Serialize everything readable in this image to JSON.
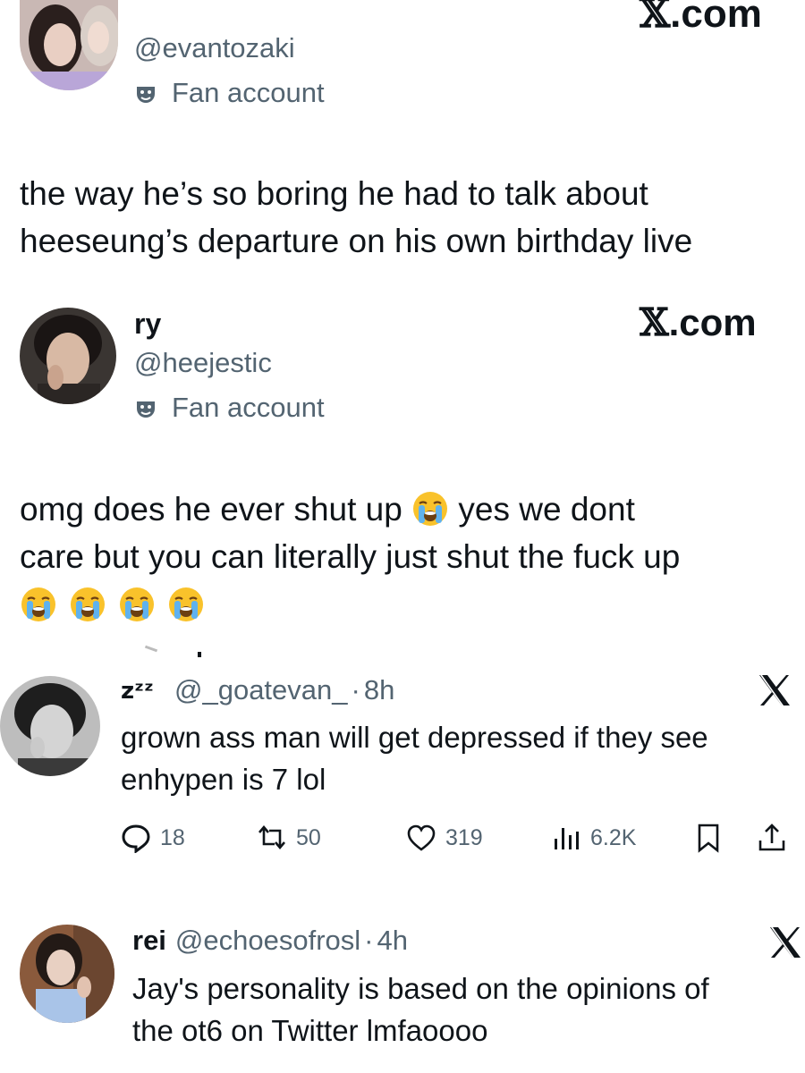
{
  "post1": {
    "handle": "@evantozaki",
    "label": "Fan account",
    "site": ".com",
    "text_lines": [
      "the way he’s so boring he had to talk about",
      "heeseung’s departure on his own birthday live"
    ]
  },
  "post2": {
    "name": "ry",
    "handle": "@heejestic",
    "label": "Fan account",
    "site": ".com",
    "text_line1_a": "omg does he ever shut up ",
    "text_line1_b": " yes we dont",
    "text_line2": "care but you can literally just shut the fuck up",
    "emoji": "loudly-crying-face-emoji",
    "trailing_emoji_count": 4
  },
  "post3": {
    "name_emoji": "zᶻᶻ",
    "handle": "@_goatevan_",
    "separator": "·",
    "time": "8h",
    "text_lines": [
      "grown ass man will get depressed if they see",
      "enhypen is 7 lol"
    ],
    "actions": {
      "replies": "18",
      "reposts": "50",
      "likes": "319",
      "views": "6.2K"
    },
    "icons": [
      "reply-icon",
      "repost-icon",
      "like-icon",
      "views-icon",
      "bookmark-icon",
      "share-icon"
    ]
  },
  "post4": {
    "name": "rei",
    "handle": "@echoesofrosl",
    "separator": "·",
    "time": "4h",
    "text_lines": [
      "Jay's personality is based on the opinions of",
      "the ot6 on Twitter lmfaoooo"
    ]
  },
  "colors": {
    "text_primary": "#0f1419",
    "text_secondary": "#536471"
  }
}
